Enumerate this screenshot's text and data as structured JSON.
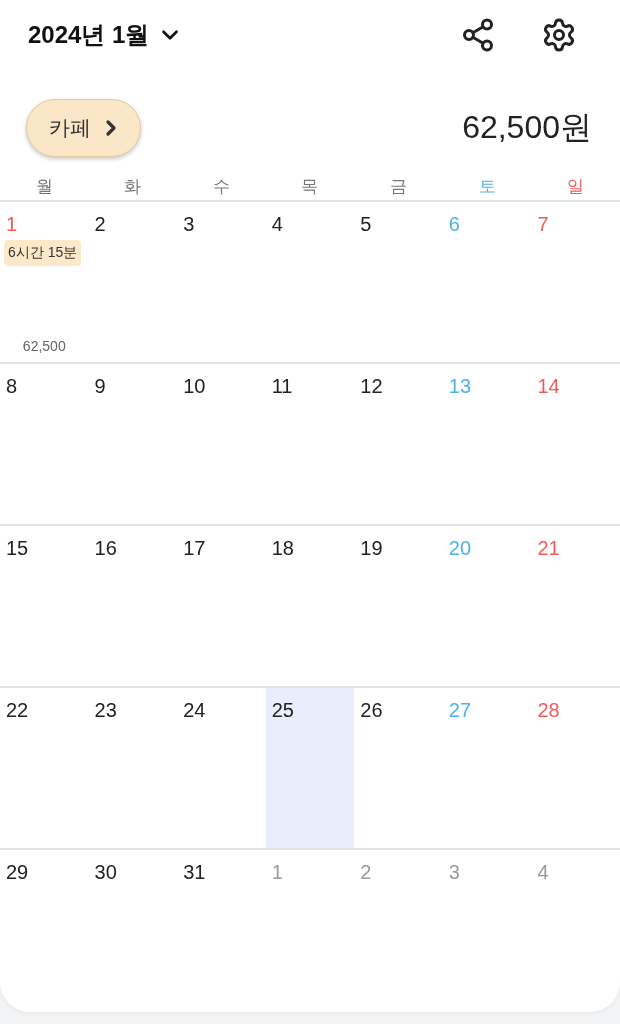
{
  "header": {
    "title": "2024년 1월"
  },
  "category": {
    "label": "카페"
  },
  "total": "62,500원",
  "weekdays": [
    {
      "label": "월",
      "kind": "weekday"
    },
    {
      "label": "화",
      "kind": "weekday"
    },
    {
      "label": "수",
      "kind": "weekday"
    },
    {
      "label": "목",
      "kind": "weekday"
    },
    {
      "label": "금",
      "kind": "weekday"
    },
    {
      "label": "토",
      "kind": "saturday"
    },
    {
      "label": "일",
      "kind": "sunday"
    }
  ],
  "weeks": [
    {
      "days": [
        {
          "label": "1",
          "kind": "holiday",
          "today": false,
          "duration": "6시간 15분",
          "amount": "62,500"
        },
        {
          "label": "2",
          "kind": "weekday",
          "today": false
        },
        {
          "label": "3",
          "kind": "weekday",
          "today": false
        },
        {
          "label": "4",
          "kind": "weekday",
          "today": false
        },
        {
          "label": "5",
          "kind": "weekday",
          "today": false
        },
        {
          "label": "6",
          "kind": "saturday",
          "today": false
        },
        {
          "label": "7",
          "kind": "sunday",
          "today": false
        }
      ]
    },
    {
      "days": [
        {
          "label": "8",
          "kind": "weekday",
          "today": false
        },
        {
          "label": "9",
          "kind": "weekday",
          "today": false
        },
        {
          "label": "10",
          "kind": "weekday",
          "today": false
        },
        {
          "label": "11",
          "kind": "weekday",
          "today": false
        },
        {
          "label": "12",
          "kind": "weekday",
          "today": false
        },
        {
          "label": "13",
          "kind": "saturday",
          "today": false
        },
        {
          "label": "14",
          "kind": "sunday",
          "today": false
        }
      ]
    },
    {
      "days": [
        {
          "label": "15",
          "kind": "weekday",
          "today": false
        },
        {
          "label": "16",
          "kind": "weekday",
          "today": false
        },
        {
          "label": "17",
          "kind": "weekday",
          "today": false
        },
        {
          "label": "18",
          "kind": "weekday",
          "today": false
        },
        {
          "label": "19",
          "kind": "weekday",
          "today": false
        },
        {
          "label": "20",
          "kind": "saturday",
          "today": false
        },
        {
          "label": "21",
          "kind": "sunday",
          "today": false
        }
      ]
    },
    {
      "days": [
        {
          "label": "22",
          "kind": "weekday",
          "today": false
        },
        {
          "label": "23",
          "kind": "weekday",
          "today": false
        },
        {
          "label": "24",
          "kind": "weekday",
          "today": false
        },
        {
          "label": "25",
          "kind": "weekday",
          "today": true
        },
        {
          "label": "26",
          "kind": "weekday",
          "today": false
        },
        {
          "label": "27",
          "kind": "saturday",
          "today": false
        },
        {
          "label": "28",
          "kind": "sunday",
          "today": false
        }
      ]
    },
    {
      "days": [
        {
          "label": "29",
          "kind": "weekday",
          "today": false
        },
        {
          "label": "30",
          "kind": "weekday",
          "today": false
        },
        {
          "label": "31",
          "kind": "weekday",
          "today": false
        },
        {
          "label": "1",
          "kind": "other_month",
          "today": false
        },
        {
          "label": "2",
          "kind": "other_month",
          "today": false
        },
        {
          "label": "3",
          "kind": "other_month",
          "today": false
        },
        {
          "label": "4",
          "kind": "other_month",
          "today": false
        }
      ]
    }
  ]
}
